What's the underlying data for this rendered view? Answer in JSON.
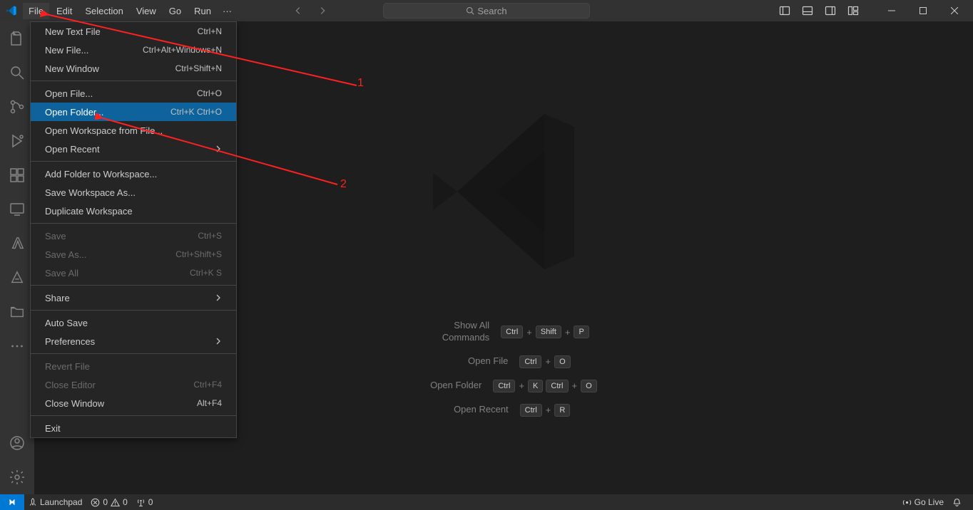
{
  "titlebar": {
    "menus": [
      "File",
      "Edit",
      "Selection",
      "View",
      "Go",
      "Run"
    ],
    "menu_ellipsis": "···",
    "search_placeholder": "Search"
  },
  "file_menu": {
    "groups": [
      [
        {
          "label": "New Text File",
          "shortcut": "Ctrl+N"
        },
        {
          "label": "New File...",
          "shortcut": "Ctrl+Alt+Windows+N"
        },
        {
          "label": "New Window",
          "shortcut": "Ctrl+Shift+N"
        }
      ],
      [
        {
          "label": "Open File...",
          "shortcut": "Ctrl+O"
        },
        {
          "label": "Open Folder...",
          "shortcut": "Ctrl+K Ctrl+O",
          "highlighted": true
        },
        {
          "label": "Open Workspace from File..."
        },
        {
          "label": "Open Recent",
          "submenu": true
        }
      ],
      [
        {
          "label": "Add Folder to Workspace..."
        },
        {
          "label": "Save Workspace As..."
        },
        {
          "label": "Duplicate Workspace"
        }
      ],
      [
        {
          "label": "Save",
          "shortcut": "Ctrl+S",
          "disabled": true
        },
        {
          "label": "Save As...",
          "shortcut": "Ctrl+Shift+S",
          "disabled": true
        },
        {
          "label": "Save All",
          "shortcut": "Ctrl+K S",
          "disabled": true
        }
      ],
      [
        {
          "label": "Share",
          "submenu": true
        }
      ],
      [
        {
          "label": "Auto Save"
        },
        {
          "label": "Preferences",
          "submenu": true
        }
      ],
      [
        {
          "label": "Revert File",
          "disabled": true
        },
        {
          "label": "Close Editor",
          "shortcut": "Ctrl+F4",
          "disabled": true
        },
        {
          "label": "Close Window",
          "shortcut": "Alt+F4"
        }
      ],
      [
        {
          "label": "Exit"
        }
      ]
    ]
  },
  "welcome": {
    "shortcuts": [
      {
        "label": "Show All Commands",
        "keys": [
          "Ctrl",
          "+",
          "Shift",
          "+",
          "P"
        ]
      },
      {
        "label": "Open File",
        "keys": [
          "Ctrl",
          "+",
          "O"
        ]
      },
      {
        "label": "Open Folder",
        "keys": [
          "Ctrl",
          "+",
          "K",
          "Ctrl",
          "+",
          "O"
        ]
      },
      {
        "label": "Open Recent",
        "keys": [
          "Ctrl",
          "+",
          "R"
        ]
      }
    ]
  },
  "status": {
    "launchpad": "Launchpad",
    "errors": "0",
    "warnings": "0",
    "ports": "0",
    "go_live": "Go Live"
  },
  "annotations": {
    "a1": "1",
    "a2": "2"
  }
}
